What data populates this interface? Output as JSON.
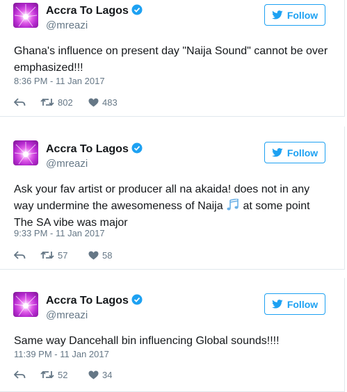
{
  "tweets": [
    {
      "author": "Accra To Lagos",
      "handle": "@mreazi",
      "follow_label": "Follow",
      "text": "Ghana's influence on present day \"Naija Sound\" cannot be over emphasized!!!",
      "timestamp": "8:36 PM - 11 Jan 2017",
      "retweets": "802",
      "likes": "483"
    },
    {
      "author": "Accra To Lagos",
      "handle": "@mreazi",
      "follow_label": "Follow",
      "text_before_emoji": "Ask your fav artist or producer all na akaida! does not in any way undermine the awesomeness of Naija ",
      "emoji": "musical-notes-icon",
      "text_after_emoji": " at some point The SA vibe was major",
      "timestamp": "9:33 PM - 11 Jan 2017",
      "retweets": "57",
      "likes": "58"
    },
    {
      "author": "Accra To Lagos",
      "handle": "@mreazi",
      "follow_label": "Follow",
      "text": "Same way Dancehall bin influencing Global sounds!!!!",
      "timestamp": "11:39 PM - 11 Jan 2017",
      "retweets": "52",
      "likes": "34"
    }
  ],
  "colors": {
    "twitter_blue": "#1da1f2",
    "secondary_text": "#657786",
    "primary_text": "#14171a",
    "border": "#e1e8ed"
  }
}
